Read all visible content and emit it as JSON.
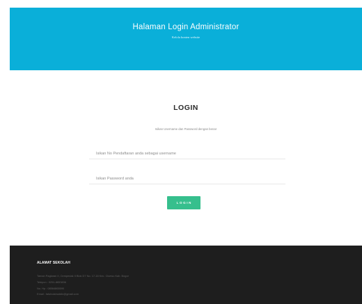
{
  "header": {
    "title": "Halaman Login Administrator",
    "subtitle": "Kelola konten website",
    "background_color": "#0aafd9"
  },
  "login": {
    "title": "LOGIN",
    "instructions": "Isikan Username dan Password dengan benar",
    "username_placeholder": "Isikan No Pendaftaran anda sebagai username",
    "password_placeholder": "Isikan Password anda",
    "button_label": "LOGIN",
    "button_color": "#36bf8d"
  },
  "footer": {
    "heading": "ALAMAT SEKOLAH",
    "background_color": "#1e1e1e",
    "lines": [
      "Taman Paglaran II, Cempedak II Blok D7 No. 17-18 Kec. Cisewu Kab. Bogor",
      "Telepon : 0251-8653836",
      "No. Hp : 08564865590",
      "Email : fatsholahuddin@gmail.com"
    ]
  }
}
